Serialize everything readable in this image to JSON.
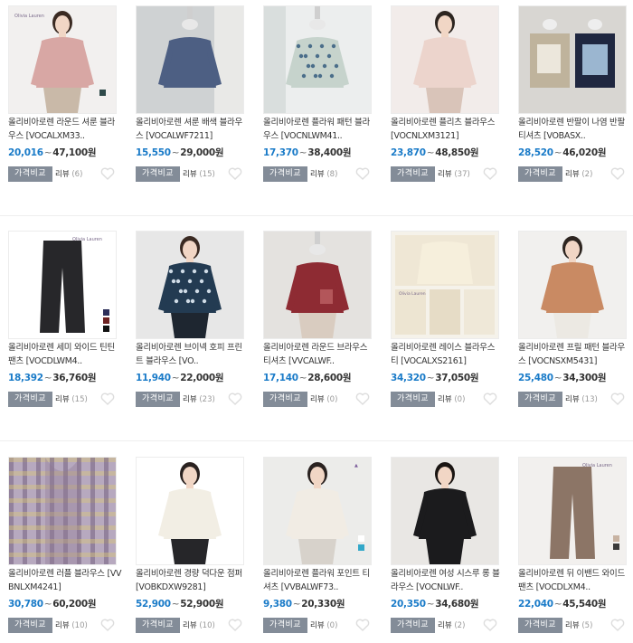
{
  "compare_label": "가격비교",
  "review_label": "리뷰",
  "tilde": "~",
  "colors": {
    "price_low": "#1a7bc8",
    "compare_btn": "#838c98",
    "heart": "#dddddd"
  },
  "products": [
    {
      "title": "올리비아로렌 라운드 셔룬 블라우스 [VOCALXM33..",
      "price_low": "20,016",
      "price_high": "47,100원",
      "reviews": "(6)",
      "img": "pink-sweater-model"
    },
    {
      "title": "올리비아로렌 셔룬 배색 블라우스 [VOCALWF7211]",
      "price_low": "15,550",
      "price_high": "29,000원",
      "reviews": "(15)",
      "img": "navy-blouse-mannequin"
    },
    {
      "title": "올리비아로렌 플라워 패턴 블라우스 [VOCNLWM41..",
      "price_low": "17,370",
      "price_high": "38,400원",
      "reviews": "(8)",
      "img": "floral-blouse-mannequin"
    },
    {
      "title": "올리비아로렌 플리츠 블라우스 [VOCNLXM3121]",
      "price_low": "23,870",
      "price_high": "48,850원",
      "reviews": "(37)",
      "img": "pink-pleated-blouse-model"
    },
    {
      "title": "올리비아로렌 반팔이 나염 반팔 티셔츠 [VOBASX..",
      "price_low": "28,520",
      "price_high": "46,020원",
      "reviews": "(2)",
      "img": "printed-tee-mannequins"
    },
    {
      "title": "올리비아로렌 세미 와이드 틴틴 팬츠 [VOCDLWM4..",
      "price_low": "18,392",
      "price_high": "36,760원",
      "reviews": "(15)",
      "img": "black-wide-pants"
    },
    {
      "title": "올리비아로렌 브이넥 호피 프린트 블라우스 [VO..",
      "price_low": "11,940",
      "price_high": "22,000원",
      "reviews": "(23)",
      "img": "navy-print-blouse-model"
    },
    {
      "title": "올리비아로렌 라운드 브라우스 티셔츠 [VVCALWF..",
      "price_low": "17,140",
      "price_high": "28,600원",
      "reviews": "(0)",
      "img": "burgundy-blouse-mannequin"
    },
    {
      "title": "올리비아로렌 레이스 블라우스 티 [VOCALXS2161]",
      "price_low": "34,320",
      "price_high": "37,050원",
      "reviews": "(0)",
      "img": "cream-lace-blouse-collage"
    },
    {
      "title": "올리비아로렌 프릴 패턴 블라우스 [VOCNSXM5431]",
      "price_low": "25,480",
      "price_high": "34,300원",
      "reviews": "(13)",
      "img": "orange-top-model"
    },
    {
      "title": "올리비아로렌 러플 블라우스 [VVBNLXM4241]",
      "price_low": "30,780",
      "price_high": "60,200원",
      "reviews": "(10)",
      "img": "plaid-ruffle-blouse"
    },
    {
      "title": "올리비아로렌 경량 덕다운 점퍼 [VOBKDXW9281]",
      "price_low": "52,900",
      "price_high": "52,900원",
      "reviews": "(10)",
      "img": "cream-down-jacket-model"
    },
    {
      "title": "올리비아로렌 플라워 포인트 티셔츠 [VVBALWF73..",
      "price_low": "9,380",
      "price_high": "20,330원",
      "reviews": "(0)",
      "img": "white-flower-tee-model"
    },
    {
      "title": "올리비아로렌 여성 시스루 롱 블라우스 [VOCNLWF..",
      "price_low": "20,350",
      "price_high": "34,680원",
      "reviews": "(2)",
      "img": "black-sheer-blouse-model"
    },
    {
      "title": "올리비아로렌 뒤 이밴드 와이드 팬츠 [VOCDLXM4..",
      "price_low": "22,040",
      "price_high": "45,540원",
      "reviews": "(5)",
      "img": "brown-wide-pants"
    }
  ]
}
